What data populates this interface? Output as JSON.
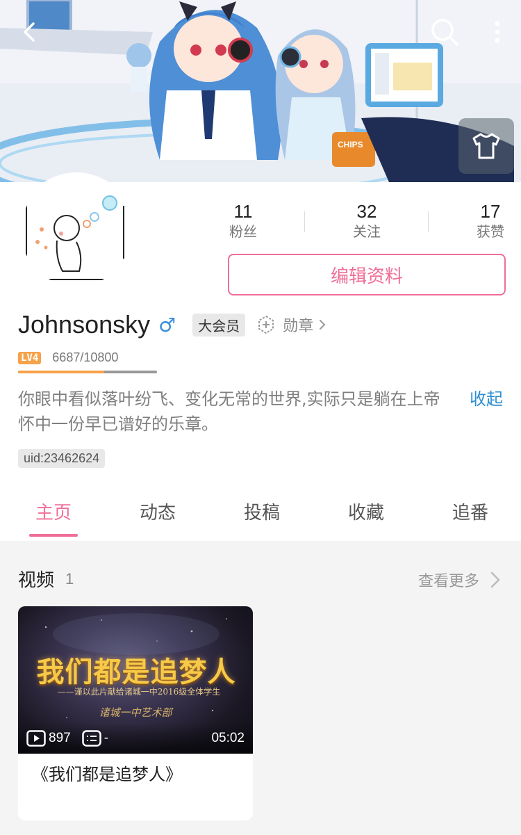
{
  "banner": {
    "art_text": "CHIPS"
  },
  "profile": {
    "stats": [
      {
        "num": "11",
        "label": "粉丝"
      },
      {
        "num": "32",
        "label": "关注"
      },
      {
        "num": "17",
        "label": "获赞"
      }
    ],
    "edit_label": "编辑资料",
    "username": "Johnsonsky",
    "gender_symbol": "♂",
    "vip_label": "大会员",
    "medal_label": "勋章",
    "level_label": "LV4",
    "exp_text": "6687/10800",
    "exp_progress": 0.619,
    "sign": "你眼中看似落叶纷飞、变化无常的世界,实际只是躺在上帝怀中一份早已谱好的乐章。",
    "collapse_label": "收起",
    "uid": "uid:23462624"
  },
  "tabs": [
    {
      "label": "主页",
      "active": true
    },
    {
      "label": "动态",
      "active": false
    },
    {
      "label": "投稿",
      "active": false
    },
    {
      "label": "收藏",
      "active": false
    },
    {
      "label": "追番",
      "active": false
    }
  ],
  "videos_section": {
    "title": "视频",
    "count": "1",
    "see_more": "查看更多",
    "items": [
      {
        "thumb_title": "我们都是追梦人",
        "thumb_subtitle": "——谨以此片献给诸城一中2016级全体学生",
        "thumb_studio": "诸城一中艺术部",
        "plays": "897",
        "danmaku": "-",
        "duration": "05:02",
        "title": "《我们都是追梦人》"
      }
    ]
  },
  "colors": {
    "accent": "#f06e97",
    "link": "#2e8fd0",
    "level": "#f6a24a",
    "gender": "#3a8ddc"
  }
}
